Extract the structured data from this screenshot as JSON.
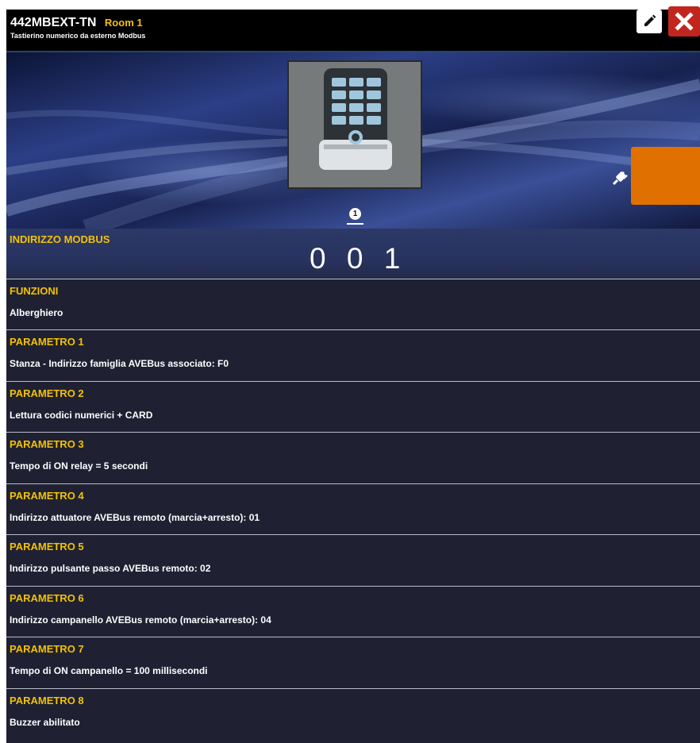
{
  "header": {
    "device_name": "442MBEXT-TN",
    "room": "Room 1",
    "subtitle": "Tastierino numerico da esterno Modbus",
    "edit_icon": "pencil-icon",
    "close_icon": "close-icon"
  },
  "hero": {
    "device_image": "keypad-device-image",
    "page_indicator": "1",
    "plug_icon": "plug-icon",
    "action_button_color": "#e07000"
  },
  "modbus": {
    "label": "INDIRIZZO MODBUS",
    "value": "0 0 1"
  },
  "sections": [
    {
      "label": "FUNZIONI",
      "value": "Alberghiero"
    },
    {
      "label": "PARAMETRO 1",
      "value": "Stanza - Indirizzo famiglia AVEBus associato: F0"
    },
    {
      "label": "PARAMETRO 2",
      "value": "Lettura codici numerici + CARD"
    },
    {
      "label": "PARAMETRO 3",
      "value": "Tempo di ON relay = 5 secondi"
    },
    {
      "label": "PARAMETRO 4",
      "value": "Indirizzo attuatore AVEBus remoto (marcia+arresto): 01"
    },
    {
      "label": "PARAMETRO 5",
      "value": "Indirizzo pulsante passo AVEBus remoto: 02"
    },
    {
      "label": "PARAMETRO 6",
      "value": "Indirizzo campanello AVEBus remoto (marcia+arresto): 04"
    },
    {
      "label": "PARAMETRO 7",
      "value": "Tempo di ON campanello = 100 millisecondi"
    },
    {
      "label": "PARAMETRO 8",
      "value": "Buzzer abilitato"
    }
  ],
  "colors": {
    "accent_label": "#f3c200",
    "background": "#1f2133",
    "close": "#c0261e",
    "action": "#e07000"
  }
}
